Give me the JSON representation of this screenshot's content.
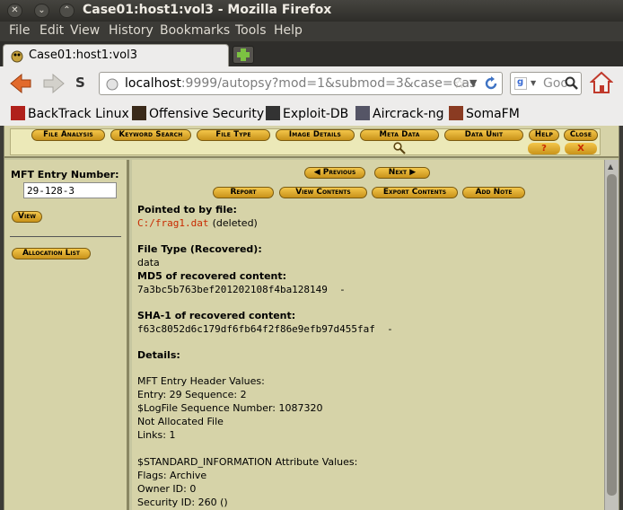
{
  "window": {
    "title": "Case01:host1:vol3 - Mozilla Firefox"
  },
  "menubar": [
    "File",
    "Edit",
    "View",
    "History",
    "Bookmarks",
    "Tools",
    "Help"
  ],
  "tab": {
    "label": "Case01:host1:vol3"
  },
  "url": {
    "host": "localhost",
    "rest": ":9999/autopsy?mod=1&submod=3&case=Cas"
  },
  "search": {
    "placeholder": "Goo"
  },
  "bookmarks": [
    "BackTrack Linux",
    "Offensive Security",
    "Exploit-DB",
    "Aircrack-ng",
    "SomaFM"
  ],
  "autopsy_nav": {
    "tabs": [
      "File Analysis",
      "Keyword Search",
      "File Type",
      "Image Details",
      "Meta Data",
      "Data Unit",
      "Help",
      "Close"
    ],
    "help_glyph": "?",
    "close_glyph": "X"
  },
  "left": {
    "mft_label": "MFT Entry Number:",
    "mft_value": "29-128-3",
    "view_btn": "View",
    "alloc_btn": "Allocation List"
  },
  "main": {
    "prev": "Previous",
    "next": "Next",
    "actions": [
      "Report",
      "View Contents",
      "Export Contents",
      "Add Note"
    ],
    "pointed_label": "Pointed to by file:",
    "pointed_file": "C:/frag1.dat",
    "pointed_status": "(deleted)",
    "filetype_label": "File Type (Recovered):",
    "filetype_value": "data",
    "md5_label": "MD5 of recovered content:",
    "md5_value": "7a3bc5b763bef201202108f4ba128149  -",
    "sha1_label": "SHA-1 of recovered content:",
    "sha1_value": "f63c8052d6c179df6fb64f2f86e9efb97d455faf  -",
    "details_label": "Details:",
    "details": [
      "MFT Entry Header Values:",
      "Entry: 29 Sequence: 2",
      "$LogFile Sequence Number: 1087320",
      "Not Allocated File",
      "Links: 1",
      "",
      "$STANDARD_INFORMATION Attribute Values:",
      "Flags: Archive",
      "Owner ID: 0",
      "Security ID: 260 ()"
    ]
  },
  "colors": {
    "accent": "#f3c64a",
    "frame_bg": "#d6d3a8",
    "link_red": "#c82a00"
  }
}
